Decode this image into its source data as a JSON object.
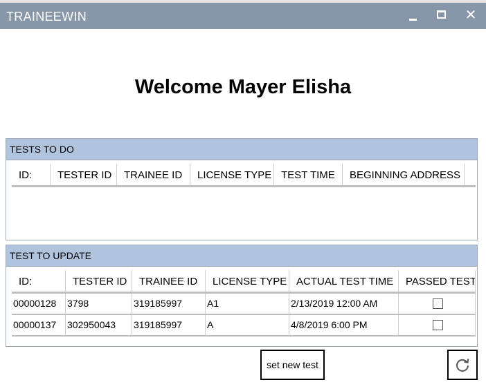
{
  "window": {
    "title": "TRAINEEWIN",
    "minimize_icon": "minimize-icon",
    "maximize_icon": "maximize-icon",
    "close_icon": "close-icon",
    "close_glyph": "✕"
  },
  "welcome_text": "Welcome Mayer Elisha",
  "tests_to_do": {
    "header": "TESTS TO DO",
    "columns": [
      "ID:",
      "TESTER ID",
      "TRAINEE ID",
      "LICENSE TYPE",
      "TEST TIME",
      "BEGINNING ADDRESS"
    ],
    "rows": []
  },
  "test_to_update": {
    "header": "TEST TO UPDATE",
    "columns": [
      "ID:",
      "TESTER ID",
      "TRAINEE ID",
      "LICENSE TYPE",
      "ACTUAL TEST TIME",
      "PASSED TEST"
    ],
    "rows": [
      {
        "id": "00000128",
        "tester_id": "3798",
        "trainee_id": "319185997",
        "license_type": "A1",
        "actual_test_time": "2/13/2019 12:00 AM",
        "passed_test": false
      },
      {
        "id": "00000137",
        "tester_id": "302950043",
        "trainee_id": "319185997",
        "license_type": "A",
        "actual_test_time": "4/8/2019 6:00 PM",
        "passed_test": false
      }
    ]
  },
  "buttons": {
    "set_new_test": "set new test",
    "refresh_icon": "refresh-icon"
  }
}
